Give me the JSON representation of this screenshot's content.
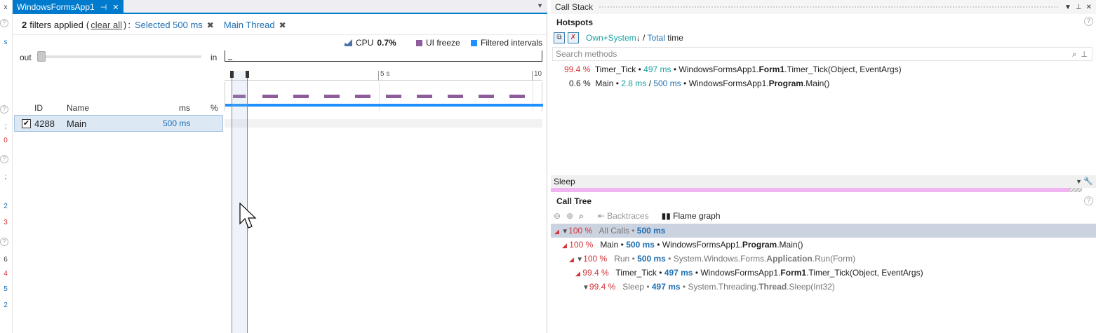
{
  "left_gutter": {
    "glyphs": [
      "x",
      "s",
      ";",
      ";",
      "0",
      "2",
      "3",
      "6",
      "4",
      "5",
      "2"
    ]
  },
  "document": {
    "tab_title": "WindowsFormsApp1",
    "filters": {
      "count": "2",
      "applied_text": "filters applied",
      "clear_all": "clear all",
      "colon": ":",
      "chips": [
        {
          "label": "Selected 500 ms"
        },
        {
          "label": "Main Thread"
        }
      ]
    },
    "legend": {
      "cpu_label": "CPU",
      "cpu_value": "0.7%",
      "ui_freeze": "UI freeze",
      "filtered_intervals": "Filtered intervals",
      "colors": {
        "cpu": "#4a74a8",
        "ui_freeze": "#8e5c9b",
        "filtered": "#1e90ff"
      }
    },
    "zoom": {
      "out_label": "out",
      "in_label": "in"
    },
    "ruler": {
      "labels": [
        "5 s",
        "10"
      ]
    },
    "thread_table": {
      "headers": {
        "id": "ID",
        "name": "Name",
        "ms": "ms",
        "pct": "%"
      },
      "rows": [
        {
          "checked": true,
          "id": "4288",
          "name": "Main",
          "ms": "500 ms"
        }
      ]
    }
  },
  "right_panel": {
    "call_stack_title": "Call Stack",
    "hotspots": {
      "title": "Hotspots",
      "mode": {
        "own_system": "Own+System",
        "arrow": "↓",
        "sep": "/",
        "total": "Total",
        "suffix": "time"
      },
      "search_placeholder": "Search methods",
      "rows": [
        {
          "pct": "99.4 %",
          "name": "Timer_Tick",
          "bullet": "•",
          "time": "497 ms",
          "bullet2": "•",
          "ns": "WindowsFormsApp1.",
          "cls": "Form1",
          "method": ".Timer_Tick(Object, EventArgs)"
        },
        {
          "pct": "0.6 %",
          "name": "Main",
          "bullet": "•",
          "time": "2.8 ms",
          "slash": "/",
          "total": "500 ms",
          "bullet2": "•",
          "ns": "WindowsFormsApp1.",
          "cls": "Program",
          "method": ".Main()"
        }
      ]
    },
    "sleep_filter": "Sleep",
    "call_tree": {
      "title": "Call Tree",
      "backtraces": "Backtraces",
      "flame_graph": "Flame graph",
      "rows": [
        {
          "pct": "100 %",
          "name": "All Calls",
          "bullet": "•",
          "time": "500 ms"
        },
        {
          "pct": "100 %",
          "name": "Main",
          "bullet": "•",
          "time": "500 ms",
          "bullet2": "•",
          "ns": "WindowsFormsApp1.",
          "cls": "Program",
          "method": ".Main()"
        },
        {
          "pct": "100 %",
          "name": "Run",
          "bullet": "•",
          "time": "500 ms",
          "bullet2": "•",
          "ns": "System.Windows.Forms.",
          "cls": "Application",
          "method": ".Run(Form)"
        },
        {
          "pct": "99.4 %",
          "name": "Timer_Tick",
          "bullet": "•",
          "time": "497 ms",
          "bullet2": "•",
          "ns": "WindowsFormsApp1.",
          "cls": "Form1",
          "method": ".Timer_Tick(Object, EventArgs)"
        },
        {
          "pct": "99.4 %",
          "name": "Sleep",
          "bullet": "•",
          "time": "497 ms",
          "bullet2": "•",
          "ns": "System.Threading.",
          "cls": "Thread",
          "method": ".Sleep(Int32)"
        }
      ]
    }
  }
}
